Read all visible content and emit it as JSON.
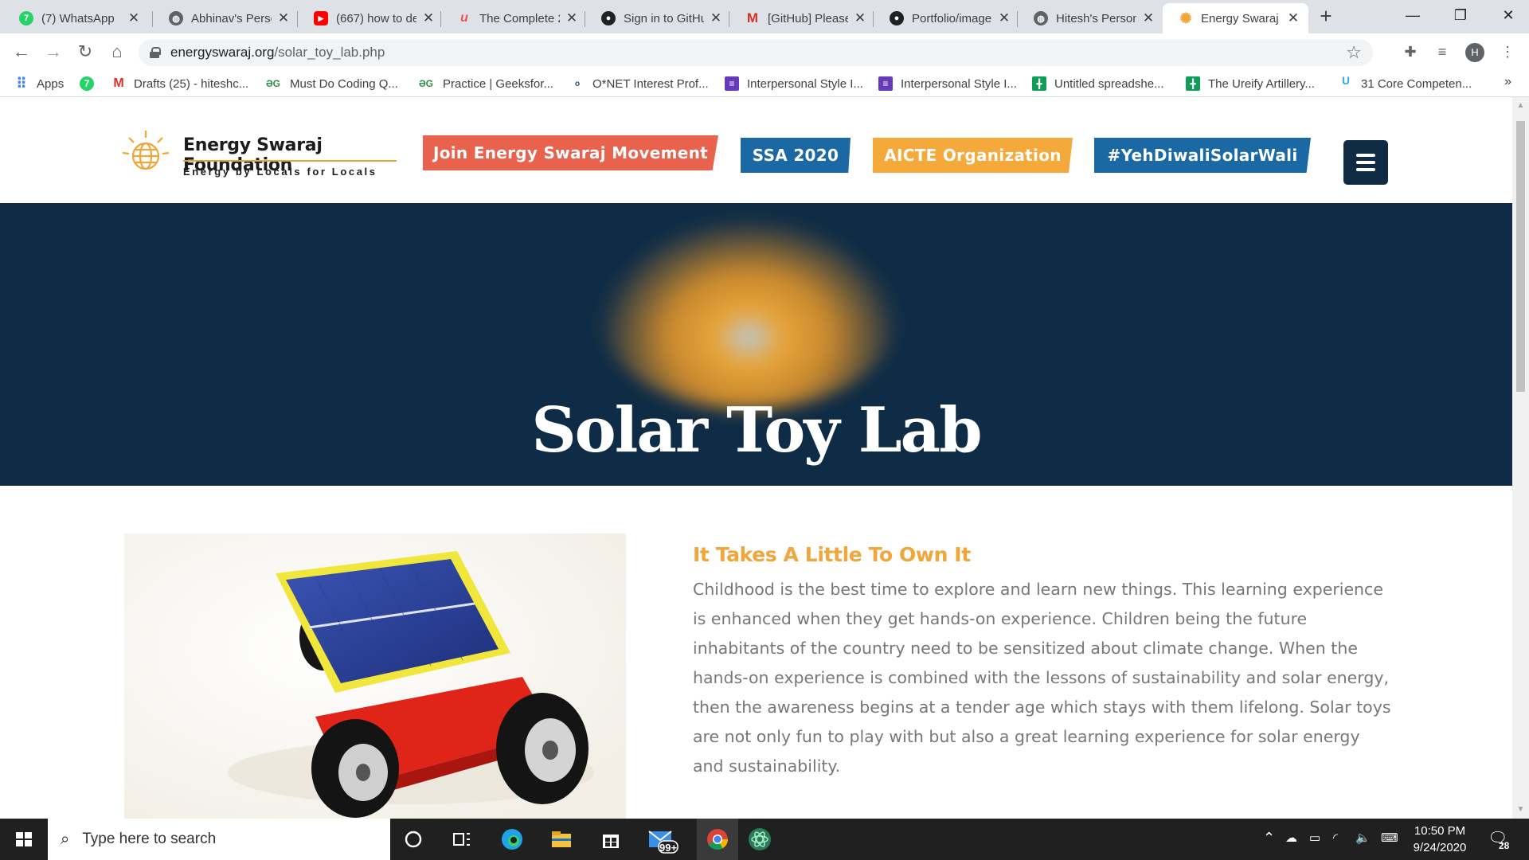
{
  "browser": {
    "tabs": [
      {
        "title": "(7) WhatsApp",
        "icon": "whatsapp-icon",
        "color": "#25D366",
        "badge": "7"
      },
      {
        "title": "Abhinav's Persona",
        "icon": "globe-icon",
        "color": "#5f6368",
        "badge": ""
      },
      {
        "title": "(667) how to de",
        "icon": "youtube-icon",
        "color": "#FF0000",
        "badge": "▶"
      },
      {
        "title": "The Complete 2",
        "icon": "udemy-icon",
        "color": "#EA5252",
        "badge": "u"
      },
      {
        "title": "Sign in to GitHub",
        "icon": "github-icon",
        "color": "#202124",
        "badge": ""
      },
      {
        "title": "[GitHub] Please",
        "icon": "gmail-icon",
        "color": "#D93025",
        "badge": "M"
      },
      {
        "title": "Portfolio/image",
        "icon": "github-icon",
        "color": "#202124",
        "badge": ""
      },
      {
        "title": "Hitesh's Person",
        "icon": "globe-icon",
        "color": "#5f6368",
        "badge": ""
      },
      {
        "title": "Energy Swaraj",
        "icon": "sun-icon",
        "color": "#F0A63A",
        "badge": "✺",
        "active": true
      }
    ],
    "url_host": "energyswaraj.org",
    "url_path": "/solar_toy_lab.php",
    "profile_initial": "H"
  },
  "bookmarks": [
    {
      "label": "Apps",
      "icon": "apps-grid-icon",
      "color": "#4285F4",
      "glyph": "⠿"
    },
    {
      "label": "",
      "icon": "whatsapp-icon",
      "color": "#25D366",
      "glyph": "7"
    },
    {
      "label": "Drafts (25) - hiteshc...",
      "icon": "gmail-icon",
      "color": "#D93025",
      "glyph": "M"
    },
    {
      "label": "Must Do Coding Q...",
      "icon": "geeksforgeeks-icon",
      "color": "#2F8D46",
      "glyph": "ƏG"
    },
    {
      "label": "Practice | Geeksfor...",
      "icon": "geeksforgeeks-icon",
      "color": "#2F8D46",
      "glyph": "ƏG"
    },
    {
      "label": "O*NET Interest Prof...",
      "icon": "onet-icon",
      "color": "#1F4E79",
      "glyph": "o"
    },
    {
      "label": "Interpersonal Style I...",
      "icon": "forms-icon",
      "color": "#673AB7",
      "glyph": "≡"
    },
    {
      "label": "Interpersonal Style I...",
      "icon": "forms-icon",
      "color": "#673AB7",
      "glyph": "≡"
    },
    {
      "label": "Untitled spreadshe...",
      "icon": "sheets-icon",
      "color": "#0F9D58",
      "glyph": "╋"
    },
    {
      "label": "The Ureify Artillery...",
      "icon": "sheets-icon",
      "color": "#0F9D58",
      "glyph": "╋"
    },
    {
      "label": "31 Core Competen...",
      "icon": "ureify-icon",
      "color": "#2FA8E0",
      "glyph": "ᵁ"
    }
  ],
  "site": {
    "logo_title": "Energy Swaraj Foundation",
    "logo_tagline": "Energy by Locals for Locals",
    "nav_buttons": [
      {
        "label": "Join Energy Swaraj Movement",
        "color": "#E8624D"
      },
      {
        "label": "SSA 2020",
        "color": "#1A69A5"
      },
      {
        "label": "AICTE Organization",
        "color": "#F4A93A"
      },
      {
        "label": "#YehDiwaliSolarWali",
        "color": "#1A69A5"
      }
    ],
    "menu_color": "#102C45"
  },
  "hero": {
    "title": "Solar Toy Lab",
    "bg_color": "#0F2C46"
  },
  "content": {
    "heading": "It Takes A Little To Own It",
    "body": "Childhood is the best time to explore and learn new things. This learning experience is enhanced when they get hands-on experience. Children being the future inhabitants of the country need to be sensitized about climate change. When the hands-on experience is combined with the lessons of sustainability and solar energy, then the awareness begins at a tender age which stays with them lifelong. Solar toys are not only fun to play with but also a great learning experience for solar energy and sustainability.",
    "image": "solar-toy-car-photo",
    "accent_color": "#F0A63A"
  },
  "taskbar": {
    "search_placeholder": "Type here to search",
    "mail_badge": "99+",
    "time": "10:50 PM",
    "date": "9/24/2020",
    "notifications": "28"
  }
}
